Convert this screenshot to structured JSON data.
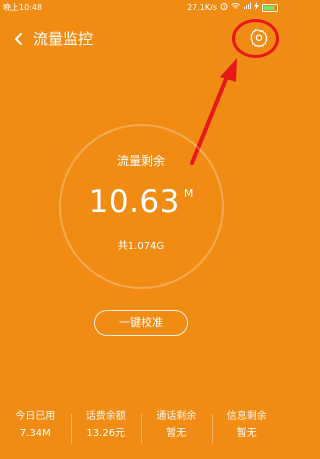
{
  "status_bar": {
    "time": "晚上10:48",
    "speed": "27.1K/s"
  },
  "header": {
    "title": "流量监控"
  },
  "monitor": {
    "label": "流量剩余",
    "value": "10.63",
    "unit": "M",
    "total": "共1.074G"
  },
  "calibrate_button": "一键校准",
  "stats": [
    {
      "label": "今日已用",
      "value": "7.34M"
    },
    {
      "label": "话费余额",
      "value": "13.26元"
    },
    {
      "label": "通话剩余",
      "value": "暂无"
    },
    {
      "label": "信息剩余",
      "value": "暂无"
    }
  ],
  "colors": {
    "background": "#F08C13",
    "annotation": "#E8171A"
  }
}
